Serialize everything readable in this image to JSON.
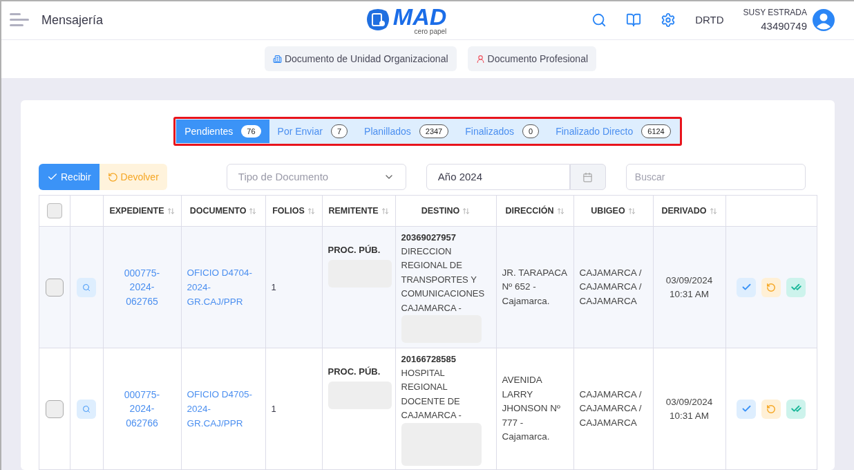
{
  "header": {
    "title": "Mensajería",
    "logo_text": "MAD",
    "logo_tagline": "cero papel",
    "office": "DRTD",
    "user_name": "SUSY ESTRADA",
    "user_id": "43490749"
  },
  "doc_types": [
    {
      "label": "Documento de Unidad Organizacional",
      "kind": "unit"
    },
    {
      "label": "Documento Profesional",
      "kind": "professional"
    }
  ],
  "tabs": [
    {
      "label": "Pendientes",
      "count": "76",
      "selected": true
    },
    {
      "label": "Por Enviar",
      "count": "7",
      "selected": false
    },
    {
      "label": "Planillados",
      "count": "2347",
      "selected": false
    },
    {
      "label": "Finalizados",
      "count": "0",
      "selected": false
    },
    {
      "label": "Finalizado Directo",
      "count": "6124",
      "selected": false
    }
  ],
  "actions": [
    {
      "label": "Recibir",
      "kind": "primary"
    },
    {
      "label": "Devolver",
      "kind": "warning"
    }
  ],
  "filters": {
    "document_type": {
      "placeholder": "Tipo de Documento"
    },
    "year": {
      "value": "Año 2024"
    },
    "search": {
      "placeholder": "Buscar"
    }
  },
  "table": {
    "select_all_checked": false,
    "columns": [
      "EXPEDIENTE",
      "DOCUMENTO",
      "FOLIOS",
      "REMITENTE",
      "DESTINO",
      "DIRECCIÓN",
      "UBIGEO",
      "DERIVADO"
    ],
    "rows": [
      {
        "checked": false,
        "highlighted": true,
        "expediente": "000775-\n2024-\n062765",
        "documento": "OFICIO D4704-\n2024-\nGR.CAJ/PPR",
        "folios": "1",
        "remitente": "PROC. PÚB.",
        "destino_ruc": "20369027957",
        "destino": "DIRECCION\nREGIONAL DE\nTRANSPORTES Y\nCOMUNICACIONES\nCAJAMARCA -",
        "direccion": "JR. TARAPACA\nNº 652 -\nCajamarca.",
        "ubigeo": "CAJAMARCA /\nCAJAMARCA /\nCAJAMARCA",
        "derivado": "03/09/2024\n10:31 AM"
      },
      {
        "checked": false,
        "highlighted": false,
        "expediente": "000775-\n2024-\n062766",
        "documento": "OFICIO D4705-\n2024-\nGR.CAJ/PPR",
        "folios": "1",
        "remitente": "PROC. PÚB.",
        "destino_ruc": "20166728585",
        "destino": "HOSPITAL\nREGIONAL\nDOCENTE DE\nCAJAMARCA -",
        "direccion": "AVENIDA\nLARRY\nJHONSON Nº\n777 -\nCajamarca.",
        "ubigeo": "CAJAMARCA /\nCAJAMARCA /\nCAJAMARCA",
        "derivado": "03/09/2024\n10:31 AM"
      }
    ]
  }
}
